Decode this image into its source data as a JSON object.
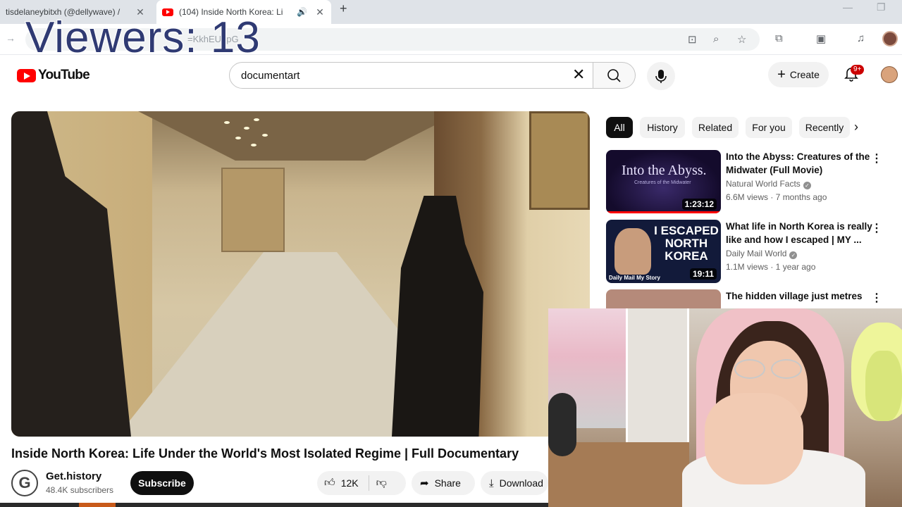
{
  "browser": {
    "tabs": [
      {
        "title": "tisdelaneybitxh (@dellywave) /",
        "active": false
      },
      {
        "title": "(104) Inside North Korea: Li",
        "active": true
      }
    ],
    "url": "=KkhEUdpG",
    "new_tab_symbol": "+"
  },
  "overlay": {
    "viewers": "Viewers: 13"
  },
  "masthead": {
    "logo_text": "YouTube",
    "search_value": "documentart",
    "create_label": "Create",
    "notification_badge": "9+"
  },
  "video": {
    "title": "Inside North Korea: Life Under the World's Most Isolated Regime | Full Documentary",
    "channel": {
      "name": "Get.history",
      "subscribers": "48.4K subscribers",
      "avatar_letter": "G"
    },
    "subscribe_label": "Subscribe",
    "likes": "12K",
    "share_label": "Share",
    "download_label": "Download"
  },
  "chips": [
    "All",
    "History",
    "Related",
    "For you",
    "Recently"
  ],
  "recommendations": [
    {
      "title": "Into the Abyss: Creatures of the Midwater (Full Movie)",
      "channel": "Natural World Facts",
      "meta": "6.6M views · 7 months ago",
      "duration": "1:23:12",
      "thumb_title": "Into the Abyss.",
      "thumb_subtitle": "Creatures of the Midwater"
    },
    {
      "title": "What life in North Korea is really like and how I escaped | MY ...",
      "channel": "Daily Mail World",
      "meta": "1.1M views · 1 year ago",
      "duration": "19:11",
      "thumb_text": "I ESCAPED NORTH KOREA",
      "thumb_brand": "Daily Mail My Story"
    },
    {
      "title": "The hidden village just metres",
      "channel": "",
      "meta": "",
      "duration": ""
    }
  ],
  "icons": {
    "tab_close": "close-icon",
    "audio": "speaker-icon",
    "search": "search-icon",
    "clear": "clear-icon",
    "mic": "mic-icon",
    "bell": "bell-icon",
    "like": "thumbs-up-icon",
    "dislike": "thumbs-down-icon",
    "share": "share-icon",
    "download": "download-icon",
    "more": "kebab-icon"
  },
  "colors": {
    "brand_red": "#ff0000",
    "badge_red": "#cc0000",
    "viewers_text": "#2f3a73"
  }
}
